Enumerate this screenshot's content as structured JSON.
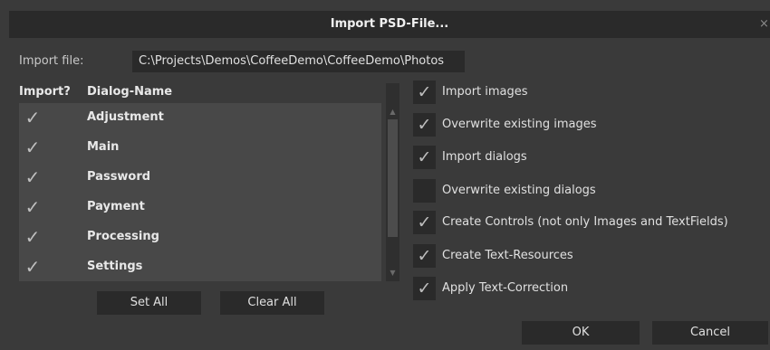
{
  "window": {
    "title": "Import PSD-File...",
    "close_glyph": "×"
  },
  "import_file": {
    "label": "Import file:",
    "value": "C:\\Projects\\Demos\\CoffeeDemo\\CoffeeDemo\\Photos"
  },
  "list": {
    "col_import": "Import?",
    "col_name": "Dialog-Name",
    "rows": [
      {
        "checked": true,
        "check_glyph": "✓",
        "name": "Adjustment"
      },
      {
        "checked": true,
        "check_glyph": "✓",
        "name": "Main"
      },
      {
        "checked": true,
        "check_glyph": "✓",
        "name": "Password"
      },
      {
        "checked": true,
        "check_glyph": "✓",
        "name": "Payment"
      },
      {
        "checked": true,
        "check_glyph": "✓",
        "name": "Processing"
      },
      {
        "checked": true,
        "check_glyph": "✓",
        "name": "Settings"
      }
    ],
    "scroll_up_glyph": "▲",
    "scroll_down_glyph": "▼"
  },
  "buttons": {
    "set_all": "Set All",
    "clear_all": "Clear All",
    "ok": "OK",
    "cancel": "Cancel"
  },
  "options": [
    {
      "label": "Import images",
      "checked": true,
      "glyph": "✓"
    },
    {
      "label": "Overwrite existing images",
      "checked": true,
      "glyph": "✓"
    },
    {
      "label": "Import dialogs",
      "checked": true,
      "glyph": "✓"
    },
    {
      "label": "Overwrite existing dialogs",
      "checked": false,
      "glyph": ""
    },
    {
      "label": "Create Controls (not only Images and TextFields)",
      "checked": true,
      "glyph": "✓"
    },
    {
      "label": "Create Text-Resources",
      "checked": true,
      "glyph": "✓"
    },
    {
      "label": "Apply Text-Correction",
      "checked": true,
      "glyph": "✓"
    }
  ],
  "colors": {
    "background": "#3a3a3a",
    "panel": "#484848",
    "field": "#2a2a2a",
    "text": "#e0e0e0",
    "check": "#bdbdbd"
  }
}
